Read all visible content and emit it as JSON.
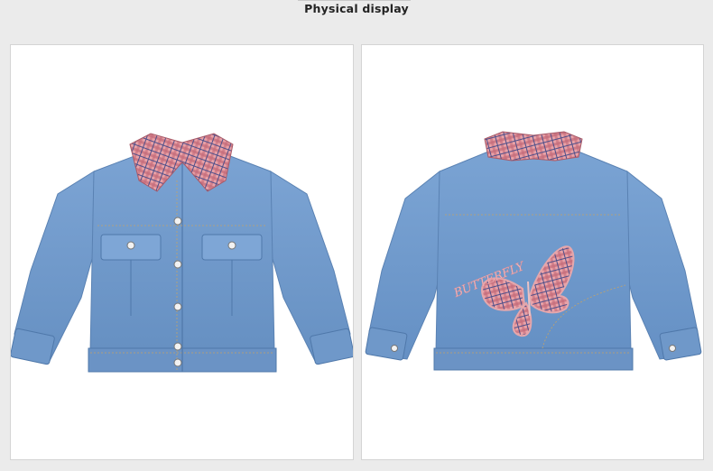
{
  "page": {
    "heading": "Physical display"
  },
  "panels": [
    {
      "view": "front",
      "description_icon": "denim-jacket-front"
    },
    {
      "view": "back",
      "description_icon": "denim-jacket-back",
      "embroidery_text": "BUTTERFLY"
    }
  ],
  "colors": {
    "page_background": "#ebebeb",
    "panel_background": "#ffffff",
    "denim": "#6f98c9",
    "denim_dark": "#4f78aa",
    "plaid_pink": "#e9a2a7",
    "plaid_accent": "#4d4f8a",
    "stitch": "#c2a36a"
  }
}
